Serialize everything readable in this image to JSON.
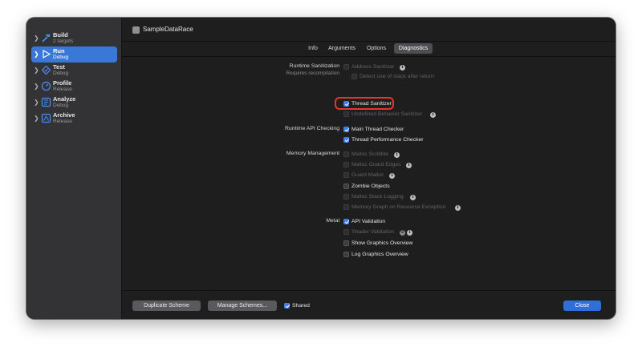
{
  "sidebar": {
    "items": [
      {
        "name": "Build",
        "sub": "2 targets",
        "icon": "hammer-icon"
      },
      {
        "name": "Run",
        "sub": "Debug",
        "icon": "play-icon",
        "selected": true
      },
      {
        "name": "Test",
        "sub": "Debug",
        "icon": "diamond-icon"
      },
      {
        "name": "Profile",
        "sub": "Release",
        "icon": "gauge-icon"
      },
      {
        "name": "Analyze",
        "sub": "Debug",
        "icon": "analyze-icon"
      },
      {
        "name": "Archive",
        "sub": "Release",
        "icon": "archive-icon"
      }
    ]
  },
  "header": {
    "title": "SampleDataRace"
  },
  "tabs": [
    {
      "label": "Info"
    },
    {
      "label": "Arguments"
    },
    {
      "label": "Options"
    },
    {
      "label": "Diagnostics",
      "active": true
    }
  ],
  "sections": {
    "runtime_sanitization": {
      "label": "Runtime Sanitization",
      "sublabel": "Requires recompilation",
      "address_sanitizer": "Address Sanitizer",
      "detect_stack": "Detect use of stack after return",
      "thread_sanitizer": "Thread Sanitizer",
      "undefined_behavior": "Undefined Behavior Sanitizer"
    },
    "runtime_api": {
      "label": "Runtime API Checking",
      "main_thread": "Main Thread Checker",
      "thread_performance": "Thread Performance Checker"
    },
    "memory": {
      "label": "Memory Management",
      "malloc_scribble": "Malloc Scribble",
      "malloc_guard_edges": "Malloc Guard Edges",
      "guard_malloc": "Guard Malloc",
      "zombie_objects": "Zombie Objects",
      "malloc_stack_logging": "Malloc Stack Logging",
      "memory_graph": "Memory Graph on Resource Exception"
    },
    "metal": {
      "label": "Metal",
      "api_validation": "API Validation",
      "shader_validation": "Shader Validation",
      "show_graphics_overview": "Show Graphics Overview",
      "log_graphics_overview": "Log Graphics Overview"
    }
  },
  "footer": {
    "duplicate_label": "Duplicate Scheme",
    "manage_label": "Manage Schemes...",
    "shared_label": "Shared",
    "close_label": "Close"
  },
  "colors": {
    "accent": "#3b7ff0",
    "highlight": "#e8342c",
    "sidebar_selected": "#3a78d8"
  }
}
